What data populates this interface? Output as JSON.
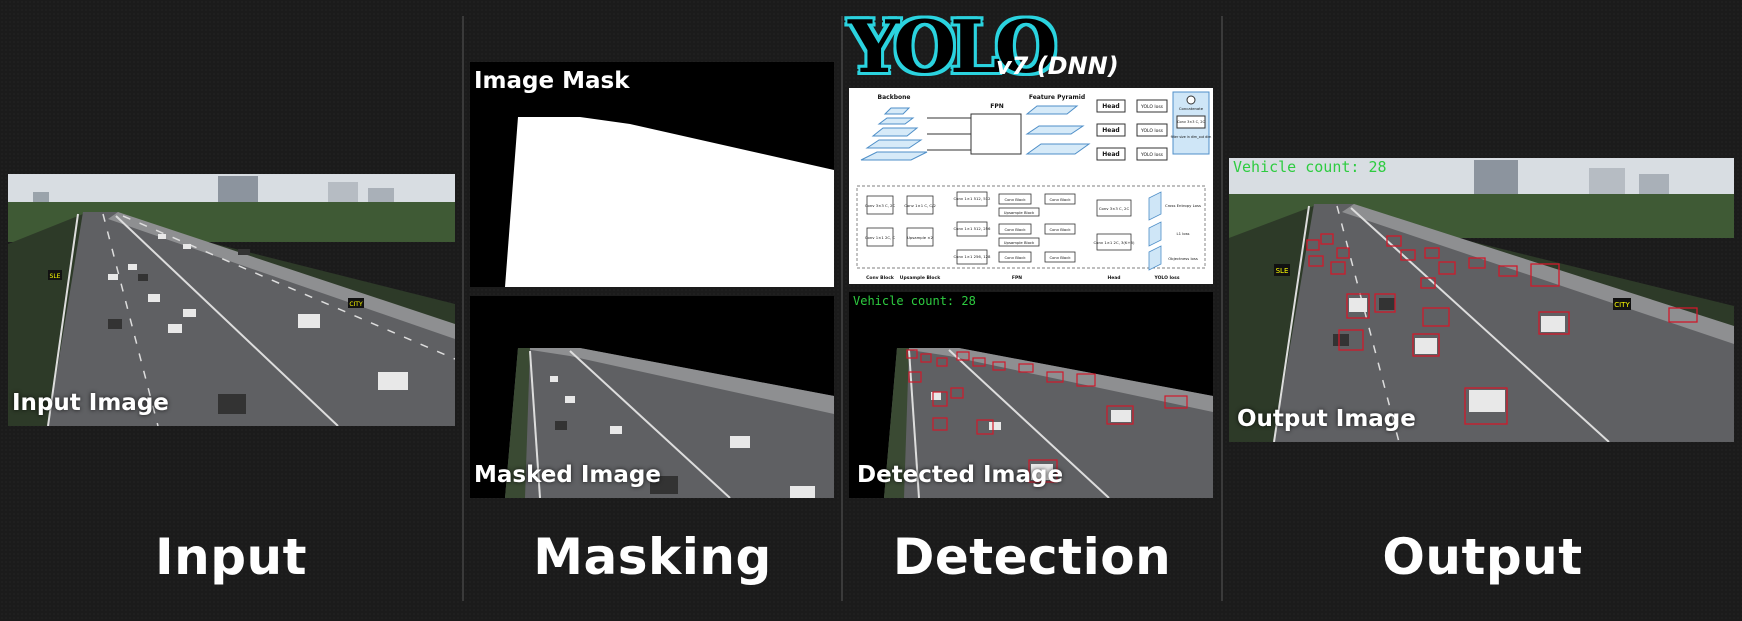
{
  "stages": [
    {
      "label": "Input"
    },
    {
      "label": "Masking"
    },
    {
      "label": "Detection"
    },
    {
      "label": "Output"
    }
  ],
  "panels": {
    "input_image": {
      "label": "Input Image"
    },
    "image_mask": {
      "label": "Image Mask"
    },
    "masked_image": {
      "label": "Masked Image"
    },
    "detected_image": {
      "label": "Detected Image",
      "count_text": "Vehicle count: 28"
    },
    "output_image": {
      "label": "Output Image",
      "count_text": "Vehicle count: 28"
    }
  },
  "yolo": {
    "logo_text": "YOLO",
    "version": "v7 (DNN)"
  },
  "architecture": {
    "sections": [
      "Backbone",
      "FPN",
      "Feature Pyramid"
    ],
    "heads": [
      "Head",
      "Head",
      "Head"
    ],
    "losses": [
      "YOLO loss",
      "YOLO loss",
      "YOLO loss"
    ],
    "bottom_labels": [
      "Conv Block",
      "Upsample Block",
      "FPN",
      "Head",
      "YOLO loss"
    ],
    "legend": [
      "Concatenate",
      "Conv 3×3 C, 2C",
      "filter size in dim_out dim"
    ],
    "blocks": [
      "Conv 1×1 512, 512",
      "Conv Block",
      "Conv Block",
      "Upsample Block",
      "Conv 1×1 512, 256",
      "Conv Block",
      "Conv Block",
      "Upsample Block",
      "Conv 1×1 256, 128",
      "Conv Block",
      "Conv Block"
    ],
    "head_blocks": [
      "Conv 3×3 C, 2C",
      "Conv 1×1 2C, 3(K+5)"
    ],
    "loss_blocks": [
      "Cross Entropy Loss",
      "L1 loss",
      "Objectness loss"
    ],
    "side_blocks": [
      "Conv 3×3 C, 2C",
      "Conv 1×1 2C, C",
      "Conv 1×1 C, C/2",
      "Upsample ×2"
    ]
  },
  "overlays": {
    "road_signs": [
      "SLE",
      "CITY"
    ]
  },
  "colors": {
    "background": "#1b1b1b",
    "detect_box": "#d0192b",
    "count_text": "#2ecc40",
    "yolo_outline": "#2bd3df"
  }
}
